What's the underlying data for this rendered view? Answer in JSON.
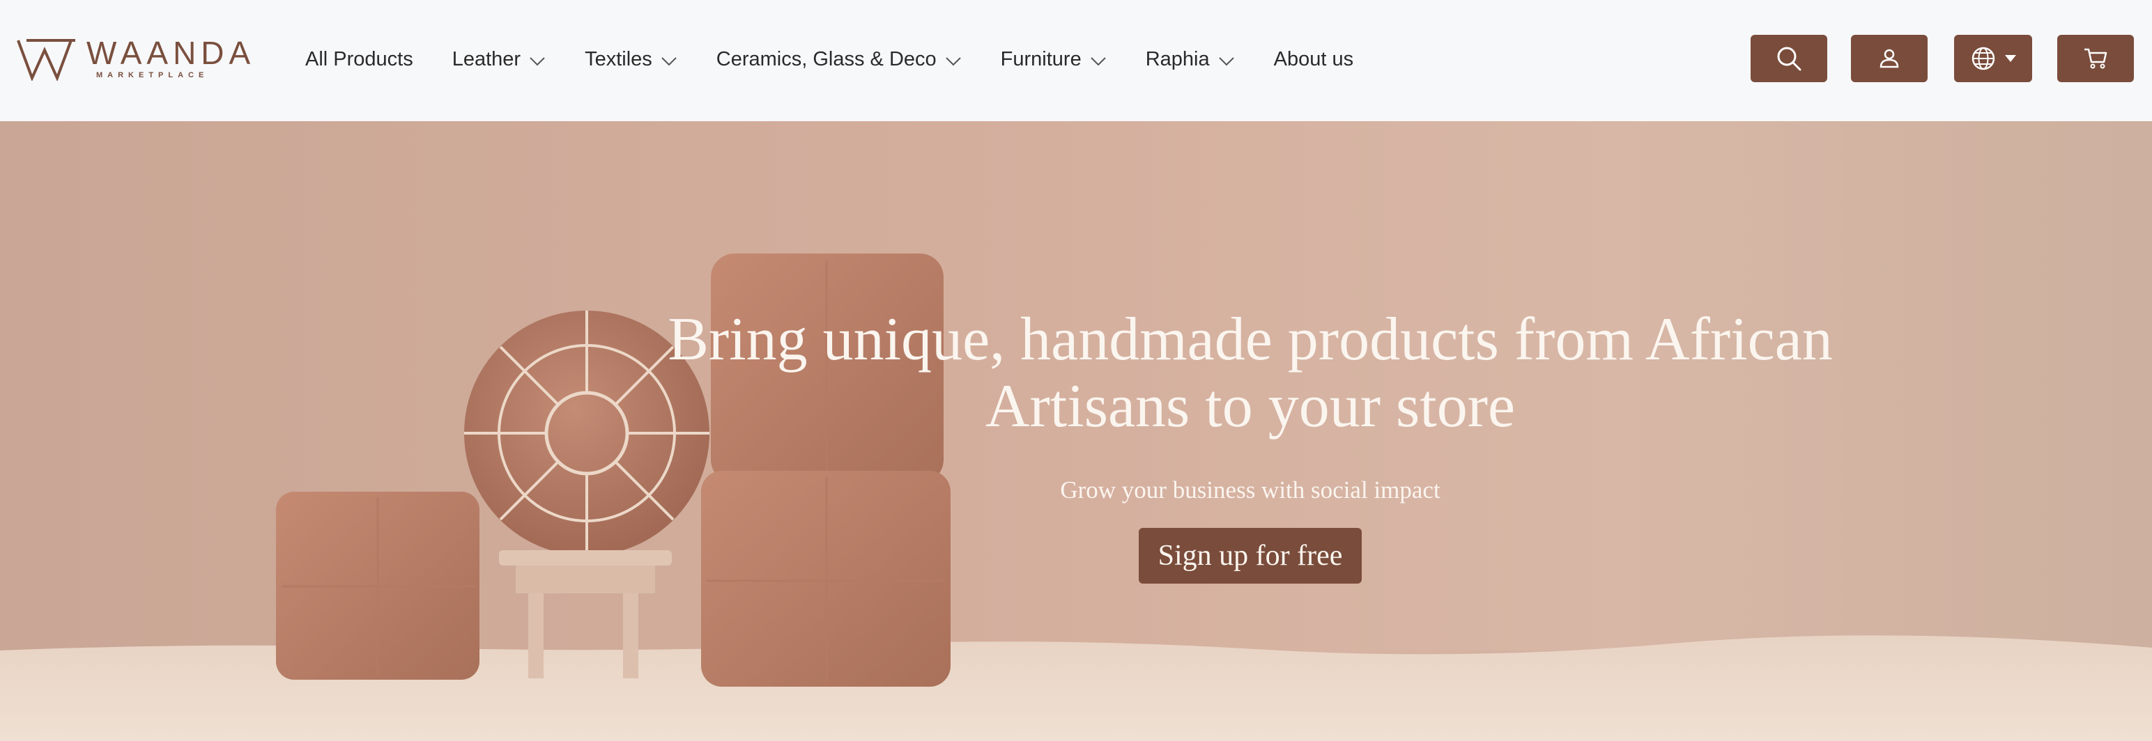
{
  "brand": {
    "name": "WAANDA",
    "tagline": "MARKETPLACE"
  },
  "nav": {
    "items": [
      {
        "label": "All Products",
        "has_dropdown": false
      },
      {
        "label": "Leather",
        "has_dropdown": true
      },
      {
        "label": "Textiles",
        "has_dropdown": true
      },
      {
        "label": "Ceramics, Glass & Deco",
        "has_dropdown": true
      },
      {
        "label": "Furniture",
        "has_dropdown": true
      },
      {
        "label": "Raphia",
        "has_dropdown": true
      },
      {
        "label": "About us",
        "has_dropdown": false
      }
    ]
  },
  "toolbar": {
    "search_icon": "search-icon",
    "account_icon": "user-icon",
    "language_icon": "globe-icon",
    "cart_icon": "cart-icon"
  },
  "hero": {
    "title_line1": "Bring unique, handmade products from African",
    "title_line2": "Artisans to your store",
    "subtitle": "Grow your business with social impact",
    "cta_label": "Sign up for free"
  },
  "colors": {
    "accent": "#7a4c3b",
    "header_bg": "#f7f8fa",
    "hero_text": "#fbf5ef"
  }
}
